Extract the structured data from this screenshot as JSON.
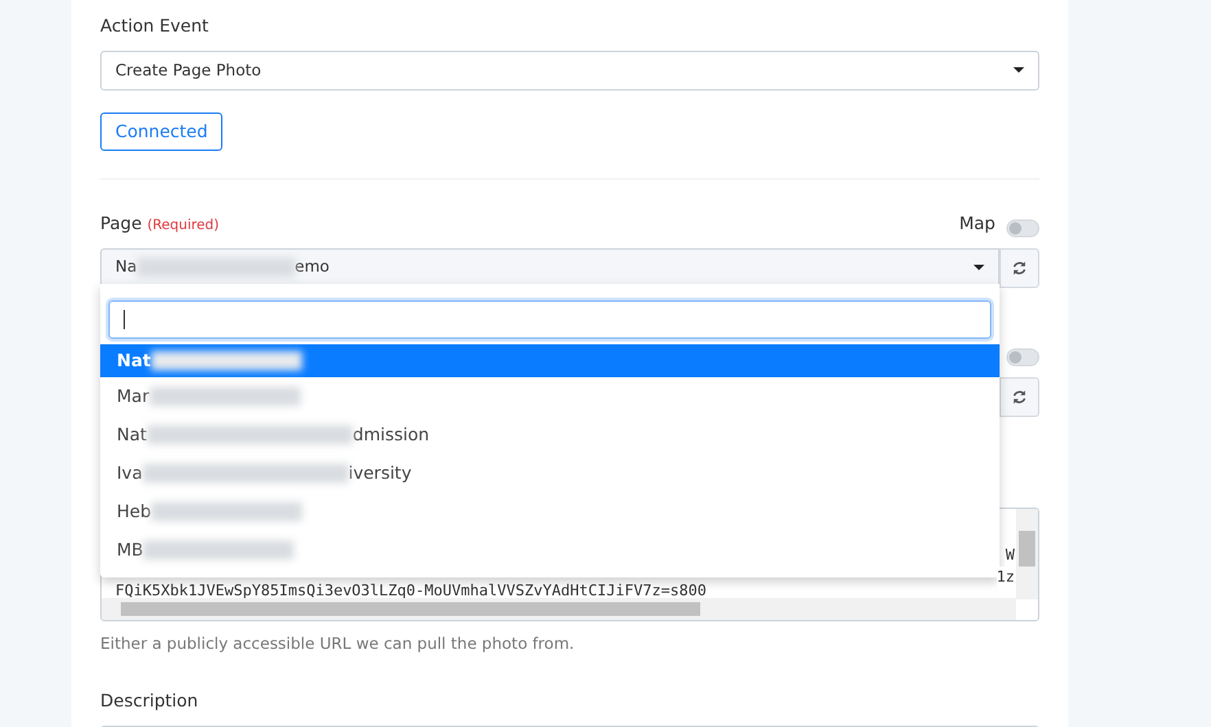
{
  "action_event": {
    "label": "Action Event",
    "value": "Create Page Photo"
  },
  "connect_button": {
    "label": "Connected"
  },
  "page_field": {
    "label": "Page",
    "required": "(Required)",
    "map_label": "Map",
    "map_on": false,
    "value_start": "Na",
    "value_end": "emo"
  },
  "dropdown": {
    "options": [
      {
        "start": "Nat",
        "selected": true
      },
      {
        "start": "Mar",
        "selected": false
      },
      {
        "start": "Nat",
        "end": "dmission",
        "selected": false
      },
      {
        "start": "Iva",
        "end": "iversity",
        "selected": false
      },
      {
        "start": "Heb",
        "selected": false
      },
      {
        "start": "MB",
        "selected": false
      }
    ]
  },
  "second_field": {
    "map_on": false
  },
  "photo_url": {
    "right_fragments": [
      "W",
      "1z"
    ],
    "last_line": "FQiK5Xbk1JVEwSpY85ImsQi3evO3lLZq0-MoUVmhalVVSZvYAdHtCIJiFV7z=s800",
    "hint": "Either a publicly accessible URL we can pull the photo from."
  },
  "description": {
    "label": "Description"
  }
}
